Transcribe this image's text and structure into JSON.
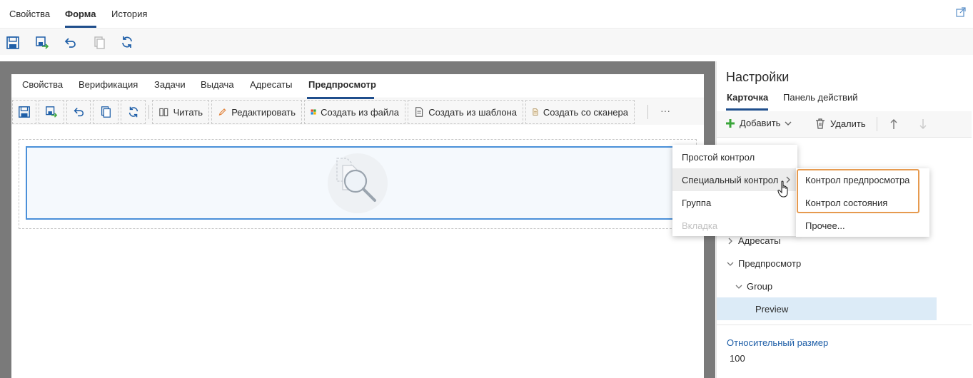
{
  "top_tabs": [
    {
      "label": "Свойства",
      "active": false
    },
    {
      "label": "Форма",
      "active": true
    },
    {
      "label": "История",
      "active": false
    }
  ],
  "top_toolbar": {
    "icons": [
      "save-icon",
      "save-and-close-icon",
      "undo-icon",
      "copy-icon",
      "refresh-icon"
    ]
  },
  "form": {
    "tabs": [
      {
        "label": "Свойства",
        "active": false
      },
      {
        "label": "Верификация",
        "active": false
      },
      {
        "label": "Задачи",
        "active": false
      },
      {
        "label": "Выдача",
        "active": false
      },
      {
        "label": "Адресаты",
        "active": false
      },
      {
        "label": "Предпросмотр",
        "active": true
      }
    ],
    "toolbar": {
      "read_label": "Читать",
      "edit_label": "Редактировать",
      "create_from_file_label": "Создать из файла",
      "create_from_template_label": "Создать из шаблона",
      "create_from_scanner_label": "Создать со сканера",
      "more_label": "···"
    }
  },
  "settings": {
    "title": "Настройки",
    "tabs": [
      {
        "label": "Карточка",
        "active": true
      },
      {
        "label": "Панель действий",
        "active": false
      }
    ],
    "toolbar": {
      "add_label": "Добавить",
      "delete_label": "Удалить"
    },
    "tree": [
      {
        "label": "Адресаты",
        "expanded": false
      },
      {
        "label": "Предпросмотр",
        "expanded": true
      },
      {
        "label": "Group",
        "expanded": true
      },
      {
        "label": "Preview",
        "selected": true
      }
    ],
    "property_label": "Относительный размер",
    "property_value": "100"
  },
  "add_menu": {
    "items": [
      {
        "label": "Простой контрол",
        "disabled": false
      },
      {
        "label": "Специальный контрол",
        "disabled": false,
        "has_submenu": true,
        "hovered": true
      },
      {
        "label": "Группа",
        "disabled": false
      },
      {
        "label": "Вкладка",
        "disabled": true
      }
    ]
  },
  "submenu": {
    "items": [
      {
        "label": "Контрол предпросмотра",
        "highlighted": true
      },
      {
        "label": "Контрол состояния",
        "highlighted": true
      },
      {
        "label": "Прочее...",
        "highlighted": false
      }
    ]
  },
  "colors": {
    "accent": "#1f4e8c",
    "link": "#1f5fa8",
    "selection": "#dcebf7",
    "highlight_border": "#e69a4f",
    "preview_border": "#4a90d9",
    "add_icon": "#3aa53a"
  }
}
